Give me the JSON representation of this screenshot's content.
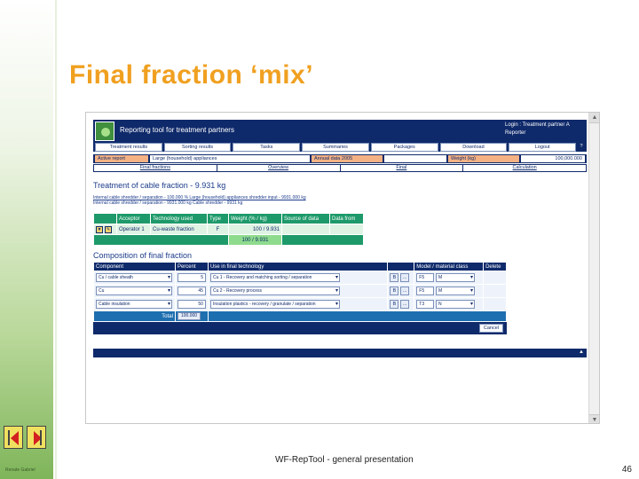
{
  "slide": {
    "title": "Final fraction ‘mix’",
    "footer": "WF-RepTool - general presentation",
    "page_number": "46",
    "author": "Renate Gabriel"
  },
  "app": {
    "title": "Reporting tool for treatment partners",
    "login_line1": "Login : Treatment partner A",
    "login_line2": "Reporter",
    "nav": [
      "Treatment results",
      "Sorting results",
      "Tasks",
      "Summaries",
      "Packages",
      "Download",
      "Logout"
    ],
    "nav_extra": "?",
    "context": {
      "label1": "Active report",
      "value1": "Large (household) appliances",
      "label2": "Annual data 2005",
      "label3": "Weight (kg)",
      "value3": "100,000.000"
    },
    "subnav": [
      "Final fractions",
      "Overview",
      "Final",
      "Calculation"
    ],
    "section1_title": "Treatment of cable fraction - 9.931 kg",
    "detail_line1": "Internal cable shredder / separation - 100.000 % Large (household) appliances shredder input - 9931.000 kg",
    "detail_line2": "Internal cable shredder / separation - 9931.000 kg Cable shredder - 9931 kg",
    "acceptor_table": {
      "headers": [
        "Acceptor",
        "Technology used",
        "Type",
        "Weight (% / kg)",
        "Source of data",
        "Data from"
      ],
      "row": {
        "icon_left": "▼",
        "icon_right": "✎",
        "acceptor": "Operator 1",
        "technology": "Cu-waste fraction",
        "type": "F",
        "weight": "100 / 9.931"
      },
      "total": "100 / 9.931"
    },
    "section2_title": "Composition of final fraction",
    "comp_table": {
      "headers": [
        "Component",
        "Percent",
        "Use in final technology",
        "",
        "Model / material class",
        "Delete"
      ],
      "rows": [
        {
          "component": "Cu / cable sheath",
          "percent": "5",
          "technology": "Cu 1 - Recovery and matching sorting / separation",
          "b1": "B",
          "b2": "...",
          "model": "F5",
          "cls": "M"
        },
        {
          "component": "Cu",
          "percent": "45",
          "technology": "Cu 2 - Recovery process",
          "b1": "B",
          "b2": "...",
          "model": "F5",
          "cls": "M"
        },
        {
          "component": "Cable insulation",
          "percent": "50",
          "technology": "Insulation plastics - recovery / granulate / separation",
          "b1": "B",
          "b2": "...",
          "model": "T3",
          "cls": "N"
        }
      ],
      "total_label": "Total",
      "total_value": "100.000",
      "cancel_label": "Cancel"
    },
    "footer_top": "▲"
  }
}
